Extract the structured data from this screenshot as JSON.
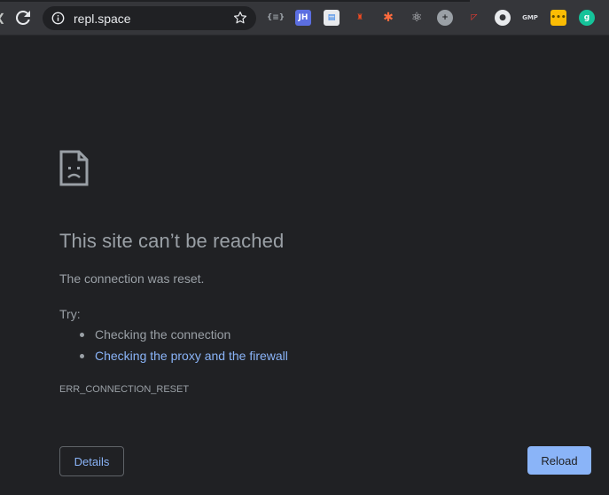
{
  "browser": {
    "url": "repl.space",
    "extensions": [
      {
        "icon": "json-viewer-icon",
        "text": "{≡}",
        "bg": "#35363a",
        "fg": "#9aa0a6"
      },
      {
        "icon": "jh-extension-icon",
        "text": "JH",
        "bg": "#5b6ee1",
        "fg": "#ffffff"
      },
      {
        "icon": "document-extension-icon",
        "text": "▤",
        "bg": "#e8eaed",
        "fg": "#1a73e8"
      },
      {
        "icon": "lighthouse-icon",
        "text": "♜",
        "bg": "#35363a",
        "fg": "#f44b21"
      },
      {
        "icon": "asterisk-extension-icon",
        "text": "✱",
        "bg": "#35363a",
        "fg": "#ff6b3d"
      },
      {
        "icon": "react-devtools-icon",
        "text": "⚛",
        "bg": "#35363a",
        "fg": "#dadce0"
      },
      {
        "icon": "plus-extension-icon",
        "text": "+",
        "bg": "#9aa0a6",
        "fg": "#202124"
      },
      {
        "icon": "redux-style-extension-icon",
        "text": "◸",
        "bg": "#35363a",
        "fg": "#ff3b30"
      },
      {
        "icon": "circle-extension-icon",
        "text": "●",
        "bg": "#e8eaed",
        "fg": "#35363a"
      },
      {
        "icon": "gmp-extension-icon",
        "text": "GMP",
        "bg": "#35363a",
        "fg": "#dadce0"
      },
      {
        "icon": "yellow-dots-extension-icon",
        "text": "•••",
        "bg": "#fbbc04",
        "fg": "#5f4b00"
      },
      {
        "icon": "grammarly-icon",
        "text": "g",
        "bg": "#15c39a",
        "fg": "#ffffff"
      }
    ]
  },
  "error": {
    "title": "This site can’t be reached",
    "description": "The connection was reset.",
    "try_label": "Try:",
    "suggestions": [
      "Checking the connection",
      "Checking the proxy and the firewall"
    ],
    "code": "ERR_CONNECTION_RESET"
  },
  "buttons": {
    "details": "Details",
    "reload": "Reload"
  },
  "colors": {
    "background": "#202124",
    "text": "#9aa0a6",
    "link": "#8ab4f8",
    "primary_button": "#8ab4f8"
  }
}
